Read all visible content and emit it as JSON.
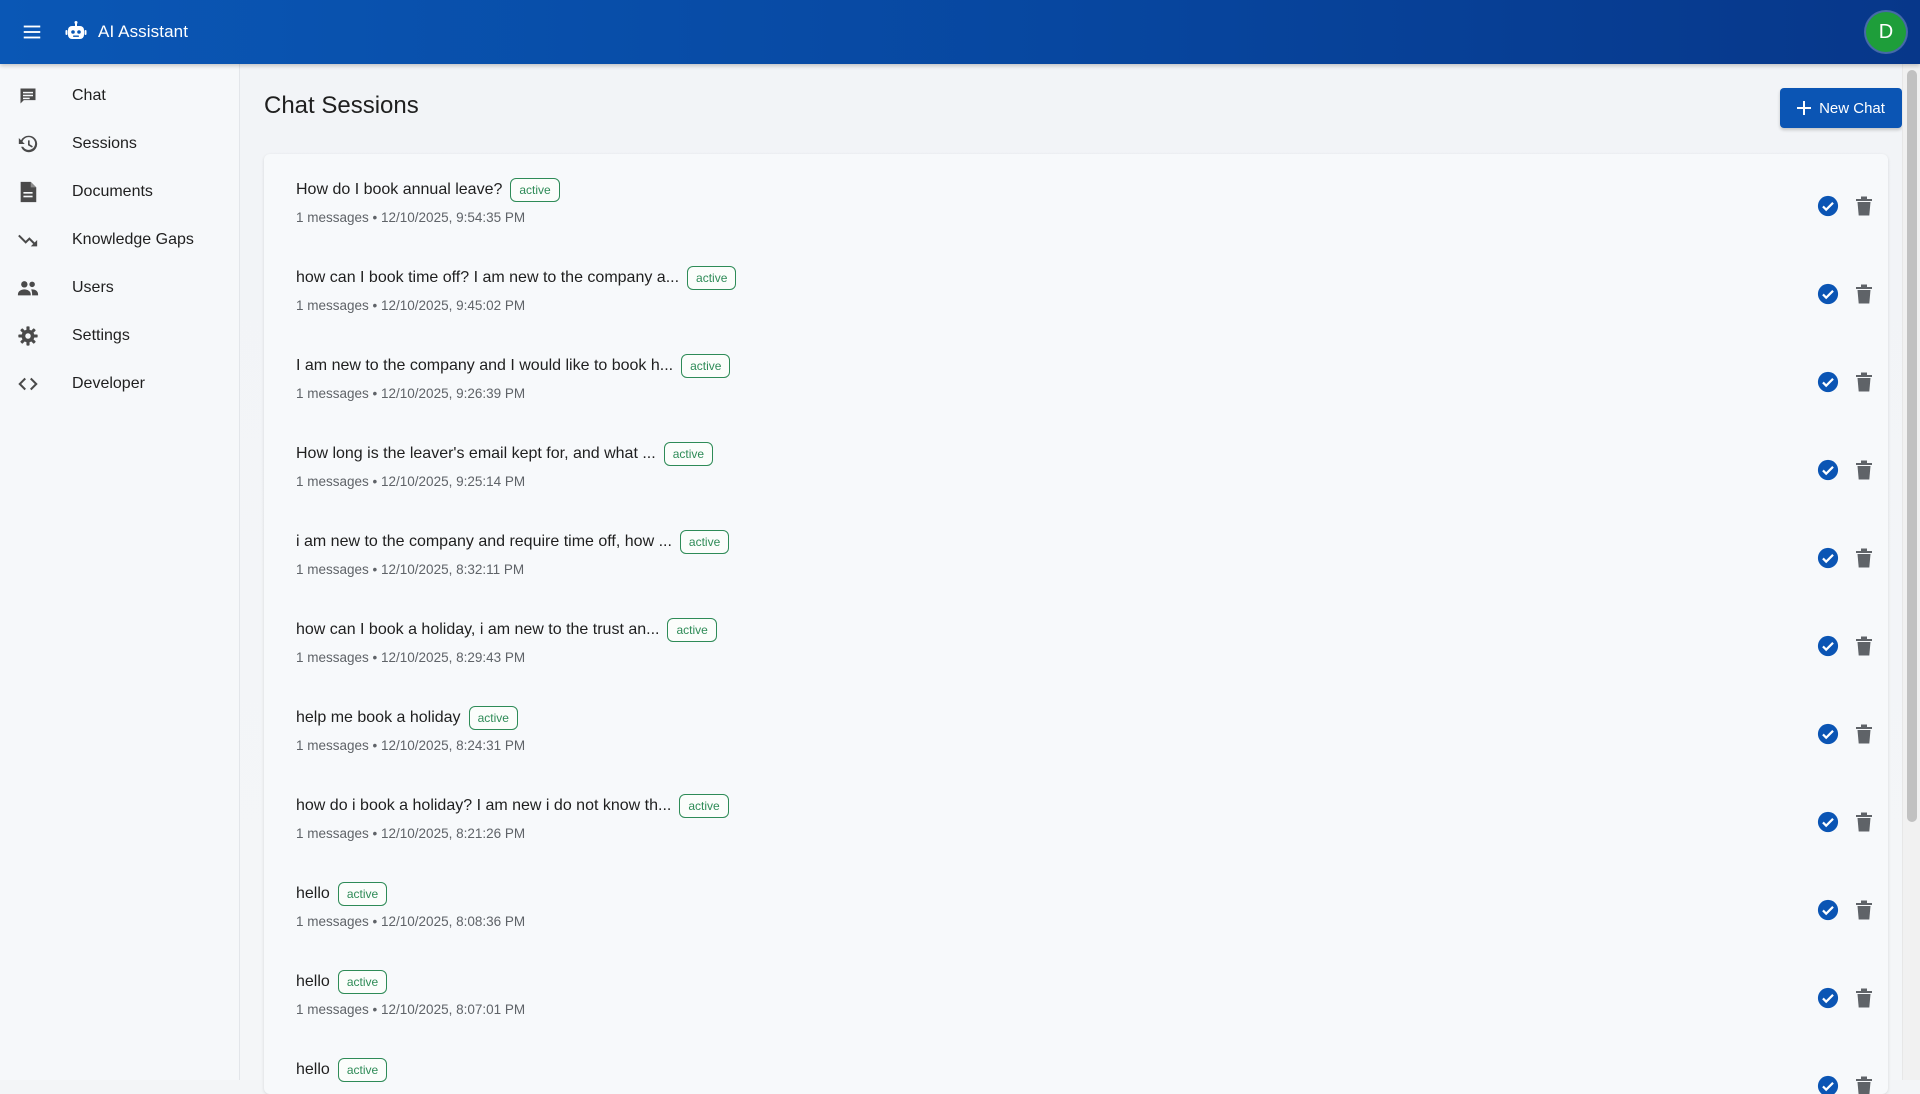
{
  "appbar": {
    "title": "AI Assistant",
    "avatar_letter": "D"
  },
  "sidebar": {
    "items": [
      {
        "label": "Chat",
        "icon": "chat-icon"
      },
      {
        "label": "Sessions",
        "icon": "history-icon"
      },
      {
        "label": "Documents",
        "icon": "document-icon"
      },
      {
        "label": "Knowledge Gaps",
        "icon": "trending-down-icon"
      },
      {
        "label": "Users",
        "icon": "users-icon"
      },
      {
        "label": "Settings",
        "icon": "gear-icon"
      },
      {
        "label": "Developer",
        "icon": "code-icon"
      }
    ]
  },
  "main": {
    "title": "Chat Sessions",
    "new_chat_label": "New Chat"
  },
  "sessions": [
    {
      "title": "How do I book annual leave?",
      "status": "active",
      "meta": "1 messages • 12/10/2025, 9:54:35 PM"
    },
    {
      "title": "how can I book time off? I am new to the company a...",
      "status": "active",
      "meta": "1 messages • 12/10/2025, 9:45:02 PM"
    },
    {
      "title": "I am new to the company and I would like to book h...",
      "status": "active",
      "meta": "1 messages • 12/10/2025, 9:26:39 PM"
    },
    {
      "title": "How long is the leaver's email kept for, and what ...",
      "status": "active",
      "meta": "1 messages • 12/10/2025, 9:25:14 PM"
    },
    {
      "title": "i am new to the company and require time off, how ...",
      "status": "active",
      "meta": "1 messages • 12/10/2025, 8:32:11 PM"
    },
    {
      "title": "how can I book a holiday, i am new to the trust an...",
      "status": "active",
      "meta": "1 messages • 12/10/2025, 8:29:43 PM"
    },
    {
      "title": "help me book a holiday",
      "status": "active",
      "meta": "1 messages • 12/10/2025, 8:24:31 PM"
    },
    {
      "title": "how do i book a holiday? I am new i do not know th...",
      "status": "active",
      "meta": "1 messages • 12/10/2025, 8:21:26 PM"
    },
    {
      "title": "hello",
      "status": "active",
      "meta": "1 messages • 12/10/2025, 8:08:36 PM"
    },
    {
      "title": "hello",
      "status": "active",
      "meta": "1 messages • 12/10/2025, 8:07:01 PM"
    },
    {
      "title": "hello",
      "status": "active",
      "meta": ""
    }
  ],
  "colors": {
    "primary": "#0b55b4",
    "active_badge": "#2e8b57",
    "avatar": "#1e9e3a"
  }
}
